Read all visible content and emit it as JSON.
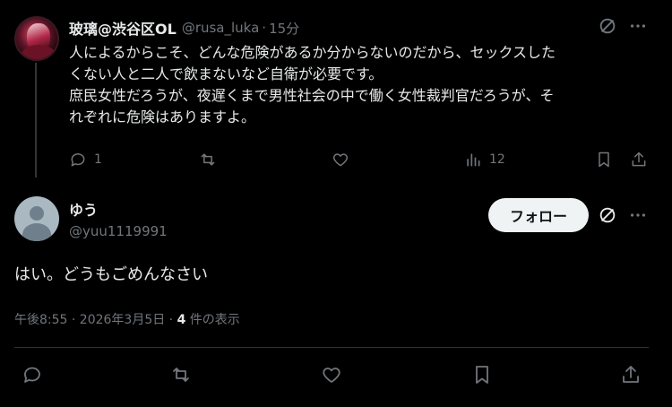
{
  "parent_tweet": {
    "author_name": "玻璃@渋谷区OL",
    "handle": "@rusa_luka",
    "separator": "·",
    "time": "15分",
    "body_lines": [
      "人によるからこそ、どんな危険があるか分からないのだから、セックスした",
      "くない人と二人で飲まないなど自衛が必要です。",
      "庶民女性だろうが、夜遅くまで男性社会の中で働く女性裁判官だろうが、そ",
      "れぞれに危険はありますよ。"
    ],
    "reply_count": "1",
    "view_count": "12"
  },
  "reply_tweet": {
    "author_name": "ゆう",
    "handle": "@yuu1119991",
    "follow_label": "フォロー",
    "text": "はい。どうもごめんなさい",
    "timestamp": "午後8:55 · 2026年3月5日 · ",
    "view_count": "4",
    "view_suffix": " 件の表示"
  },
  "icons": [
    "grok-icon",
    "more-icon",
    "reply-icon",
    "retweet-icon",
    "like-icon",
    "views-icon",
    "bookmark-icon",
    "share-icon"
  ],
  "colors": {
    "background": "#000000",
    "text": "#e7e9ea",
    "muted": "#71767b",
    "follow_bg": "#eff3f4"
  }
}
